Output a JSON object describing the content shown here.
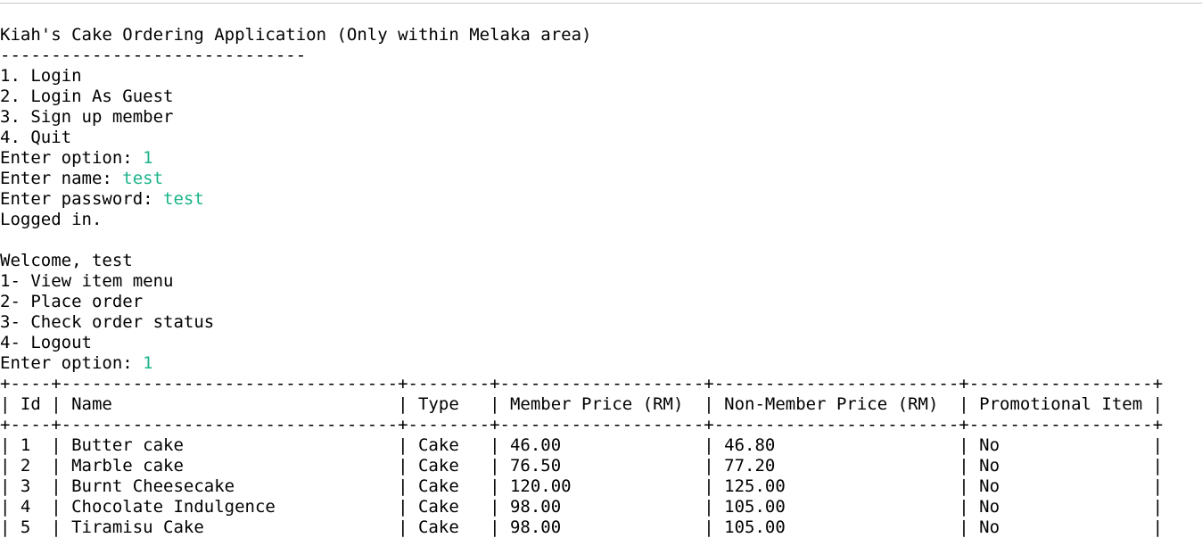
{
  "colors": {
    "background": "#ffffff",
    "text": "#000000",
    "user_input": "#1ab389"
  },
  "console": {
    "title": "Kiah's Cake Ordering Application (Only within Melaka area)",
    "title_underline": "------------------------------",
    "main_menu": [
      "1. Login",
      "2. Login As Guest",
      "3. Sign up member",
      "4. Quit"
    ],
    "prompt_option_1": "Enter option: ",
    "input_option_1": "1",
    "prompt_name": "Enter name: ",
    "input_name": "test",
    "prompt_password": "Enter password: ",
    "input_password": "test",
    "status_logged_in": "Logged in.",
    "welcome": "Welcome, test",
    "member_menu": [
      "1- View item menu",
      "2- Place order",
      "3- Check order status",
      "4- Logout"
    ],
    "prompt_option_2": "Enter option: ",
    "input_option_2": "1",
    "table": {
      "border": "+----+---------------------------------+--------+--------------------+------------------------+------------------+",
      "header": "| Id | Name                            | Type   | Member Price (RM)  | Non-Member Price (RM)  | Promotional Item |",
      "rows": [
        "| 1  | Butter cake                     | Cake   | 46.00              | 46.80                  | No               |",
        "| 2  | Marble cake                     | Cake   | 76.50              | 77.20                  | No               |",
        "| 3  | Burnt Cheesecake                | Cake   | 120.00             | 125.00                 | No               |",
        "| 4  | Chocolate Indulgence            | Cake   | 98.00              | 105.00                 | No               |",
        "| 5  | Tiramisu Cake                   | Cake   | 98.00              | 105.00                 | No               |"
      ]
    }
  }
}
